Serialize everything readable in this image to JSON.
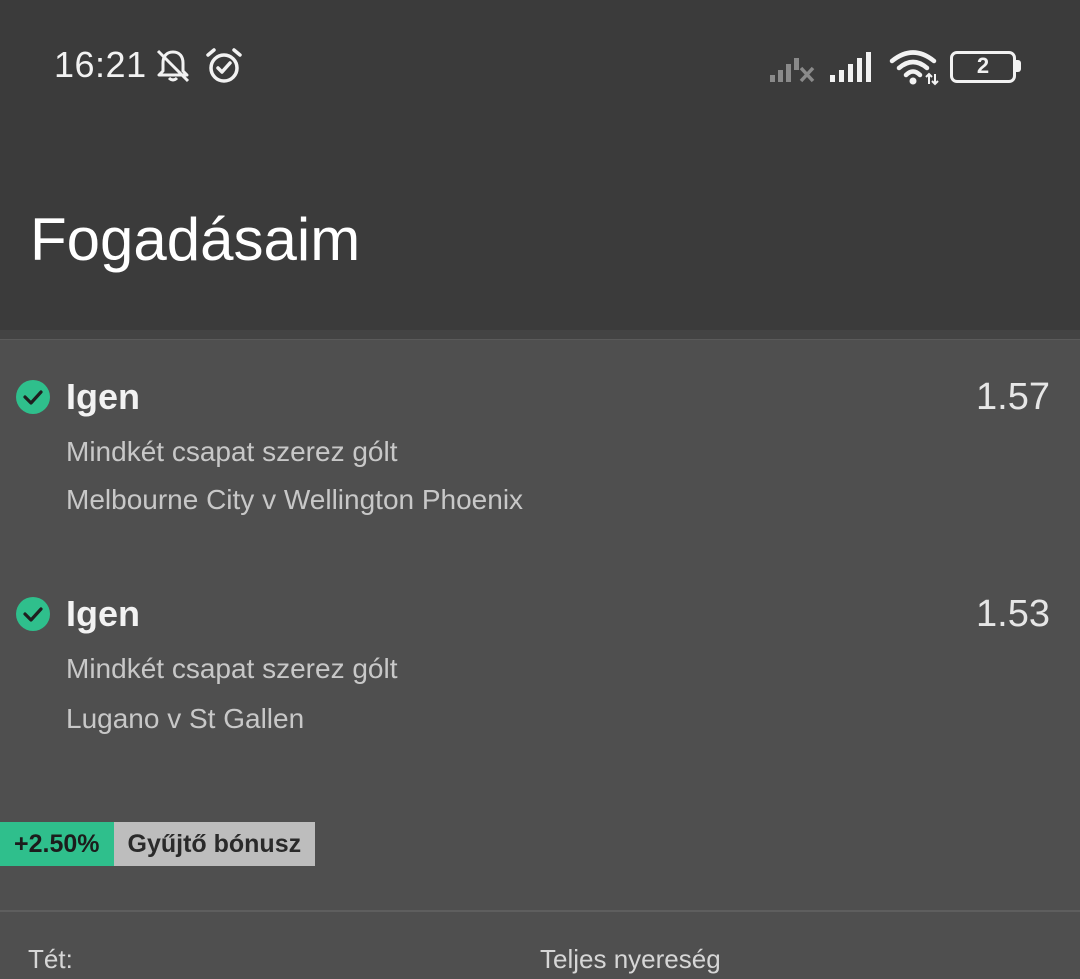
{
  "status_bar": {
    "time": "16:21",
    "battery_level": "2",
    "icons": [
      "muted-bell-icon",
      "alarm-clock-icon",
      "no-signal-icon",
      "signal-icon",
      "wifi-icon",
      "battery-icon"
    ]
  },
  "page": {
    "title": "Fogadásaim"
  },
  "bets": [
    {
      "status_icon": "check-circle-icon",
      "selection": "Igen",
      "odds": "1.57",
      "market": "Mindkét csapat szerez gólt",
      "event": "Melbourne City v Wellington Phoenix"
    },
    {
      "status_icon": "check-circle-icon",
      "selection": "Igen",
      "odds": "1.53",
      "market": "Mindkét csapat szerez gólt",
      "event": "Lugano v St Gallen"
    }
  ],
  "bonus": {
    "percent": "+2.50%",
    "label": "Gyűjtő bónusz"
  },
  "footer": {
    "stake_label": "Tét:",
    "total_win_label": "Teljes nyereség"
  },
  "colors": {
    "header_bg": "#3b3b3b",
    "content_bg": "#4f4f4f",
    "accent_green": "#2fbf8c",
    "bonus_label_bg": "#bdbdbd"
  }
}
